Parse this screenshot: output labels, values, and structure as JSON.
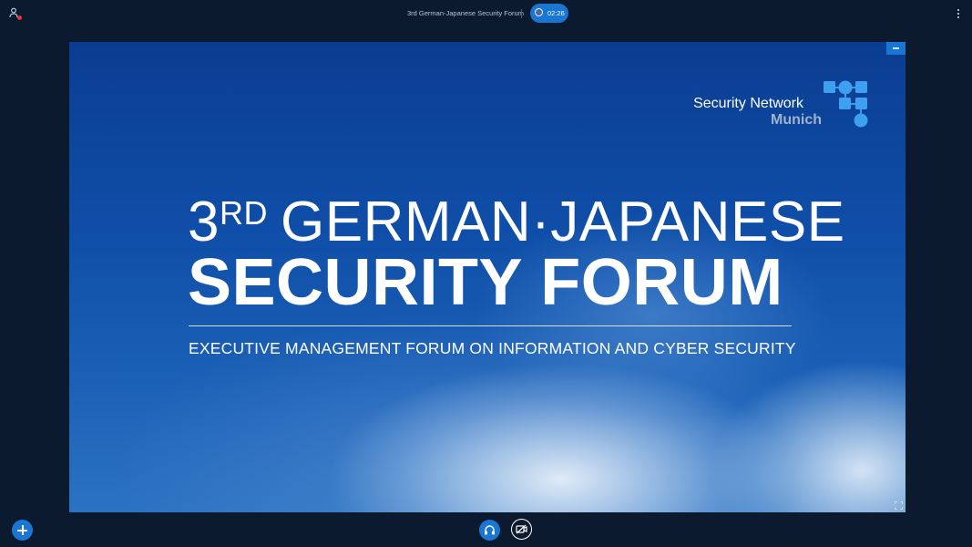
{
  "header": {
    "meeting_title": "3rd German-Japanese Security Forum",
    "recording_time": "02:26"
  },
  "slide": {
    "logo": {
      "line1": "Security Network",
      "line2": "Munich"
    },
    "title_line1_ordinal": "3",
    "title_line1_suffix": "RD",
    "title_line1_rest": "GERMAN·JAPANESE",
    "title_line2": "SECURITY FORUM",
    "subtitle": "EXECUTIVE MANAGEMENT FORUM ON INFORMATION AND CYBER SECURITY"
  },
  "colors": {
    "background": "#0b1a2e",
    "accent": "#1976d2",
    "recording_dot": "#e8303a"
  },
  "icons": {
    "top_left": "user-list-icon",
    "recording": "record-icon",
    "menu": "more-vertical-icon",
    "minimize": "minimize-icon",
    "fullscreen": "fullscreen-icon",
    "actions": "plus-icon",
    "audio": "headphones-icon",
    "video": "video-off-icon"
  }
}
